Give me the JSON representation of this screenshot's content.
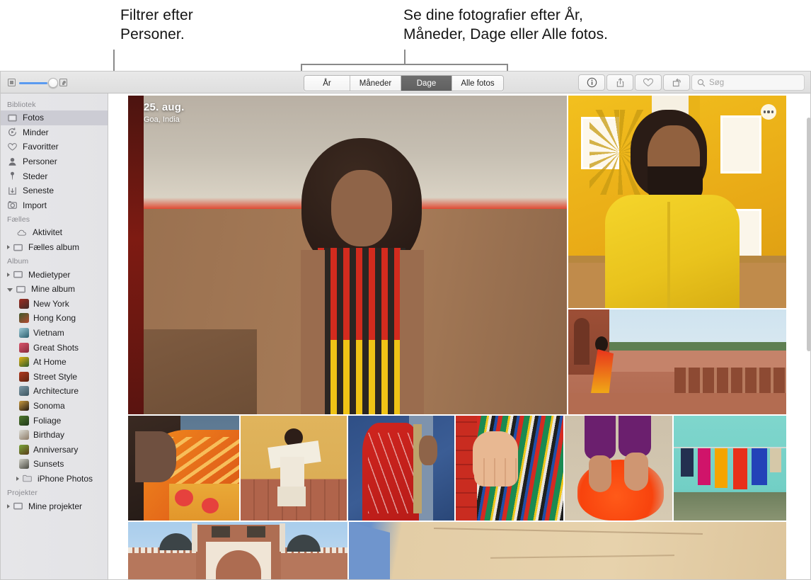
{
  "callouts": [
    {
      "id": "people",
      "text": "Filtrer efter\nPersoner."
    },
    {
      "id": "views",
      "text": "Se dine fotografier efter År,\nMåneder, Dage eller Alle fotos."
    }
  ],
  "toolbar": {
    "zoom_slider": {
      "min_icon": "small-thumbnail-icon",
      "max_icon": "large-thumbnail-icon",
      "value_percent": 78
    },
    "view_segments": [
      {
        "label": "År",
        "selected": false
      },
      {
        "label": "Måneder",
        "selected": false
      },
      {
        "label": "Dage",
        "selected": true
      },
      {
        "label": "Alle fotos",
        "selected": false
      }
    ],
    "buttons": [
      {
        "name": "info-button",
        "icon": "info-icon"
      },
      {
        "name": "share-button",
        "icon": "share-icon"
      },
      {
        "name": "favorite-button",
        "icon": "heart-icon"
      },
      {
        "name": "rotate-button",
        "icon": "rotate-icon"
      }
    ],
    "search": {
      "placeholder": "Søg",
      "value": "",
      "icon": "search-icon"
    }
  },
  "sidebar": {
    "sections": [
      {
        "title": "Bibliotek",
        "items": [
          {
            "label": "Fotos",
            "icon": "photos-icon",
            "selected": true
          },
          {
            "label": "Minder",
            "icon": "memories-icon",
            "selected": false
          },
          {
            "label": "Favoritter",
            "icon": "heart-icon",
            "selected": false
          },
          {
            "label": "Personer",
            "icon": "person-icon",
            "selected": false
          },
          {
            "label": "Steder",
            "icon": "pin-icon",
            "selected": false
          },
          {
            "label": "Seneste",
            "icon": "recents-icon",
            "selected": false
          },
          {
            "label": "Import",
            "icon": "import-icon",
            "selected": false
          }
        ]
      },
      {
        "title": "Fælles",
        "items": [
          {
            "label": "Aktivitet",
            "icon": "cloud-icon",
            "selected": false
          },
          {
            "label": "Fælles album",
            "icon": "folder-icon",
            "selected": false,
            "disclosure": "closed"
          }
        ]
      },
      {
        "title": "Album",
        "items": [
          {
            "label": "Medietyper",
            "icon": "folder-icon",
            "selected": false,
            "disclosure": "closed"
          },
          {
            "label": "Mine album",
            "icon": "folder-icon",
            "selected": false,
            "disclosure": "open"
          }
        ],
        "albums": [
          {
            "label": "New York",
            "c1": "#a02d22",
            "c2": "#3f2b27"
          },
          {
            "label": "Hong Kong",
            "c1": "#3f5a2a",
            "c2": "#b34a31"
          },
          {
            "label": "Vietnam",
            "c1": "#9ecbd8",
            "c2": "#2c5f6e"
          },
          {
            "label": "Great Shots",
            "c1": "#d9566d",
            "c2": "#8a2a3c"
          },
          {
            "label": "At Home",
            "c1": "#e0b215",
            "c2": "#2e5c2a"
          },
          {
            "label": "Street Style",
            "c1": "#b1391f",
            "c2": "#5d2411"
          },
          {
            "label": "Architecture",
            "c1": "#7e9aa8",
            "c2": "#3d5560"
          },
          {
            "label": "Sonoma",
            "c1": "#c99a3f",
            "c2": "#241a12"
          },
          {
            "label": "Foliage",
            "c1": "#4f7a2c",
            "c2": "#20381a"
          },
          {
            "label": "Birthday",
            "c1": "#dcdcd6",
            "c2": "#8d7b67"
          },
          {
            "label": "Anniversary",
            "c1": "#7aa83c",
            "c2": "#5a3b18"
          },
          {
            "label": "Sunsets",
            "c1": "#cfcfc6",
            "c2": "#4b4b43"
          }
        ],
        "sub_folders": [
          {
            "label": "iPhone Photos",
            "icon": "folder-icon",
            "disclosure": "closed"
          }
        ]
      },
      {
        "title": "Projekter",
        "items": [
          {
            "label": "Mine projekter",
            "icon": "folder-icon",
            "selected": false,
            "disclosure": "closed"
          }
        ]
      }
    ]
  },
  "photo_grid": {
    "day_header": {
      "date": "25. aug.",
      "location": "Goa, India"
    },
    "more_button": "more-options-icon",
    "photos": [
      {
        "name": "woman-striped-dress-red-wall"
      },
      {
        "name": "man-yellow-kurta"
      },
      {
        "name": "woman-red-sari-taj-terrace"
      },
      {
        "name": "woman-orange-headscarf"
      },
      {
        "name": "woman-white-sari-spinning"
      },
      {
        "name": "woman-red-sari-blue-wall"
      },
      {
        "name": "hand-on-striped-fabric"
      },
      {
        "name": "feet-orange-powder"
      },
      {
        "name": "laundry-teal-wall"
      },
      {
        "name": "mughal-monument-domes"
      },
      {
        "name": "sandstone-wall-sky"
      }
    ]
  },
  "colors": {
    "accent_blue": "#5b9bf0",
    "segment_active": "#666666",
    "sidebar_bg": "#e5e5e8",
    "sidebar_selection": "#ccccd4",
    "callout_line": "#8a8a8a"
  }
}
